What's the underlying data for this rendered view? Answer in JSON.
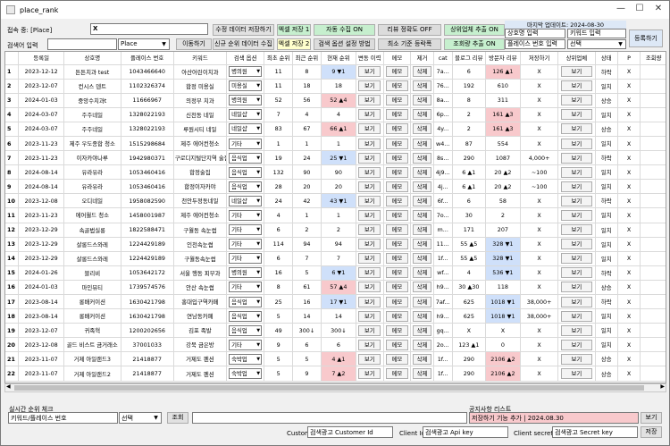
{
  "window": {
    "title": "place_rank",
    "min": "—",
    "max": "☐",
    "close": "✕"
  },
  "top": {
    "access_label": "접속 중: [Place]",
    "access_value": "X",
    "search_label": "검색어 입력",
    "place_select": "Place",
    "move_btn": "이동하기",
    "edit_save_btn": "수정 데이터 저장하기",
    "new_save_btn": "신규 순위 데이터 수집",
    "excel_save1": "엑셀 저장 1",
    "excel_save2": "엑셀 저장 2",
    "auto_collect": "자동 수집 ON",
    "search_setting": "검색 옵션 설정 방법",
    "review_off": "리뷰 정확도 OFF",
    "min_reg": "최소 기준 등락폭",
    "top_extract": "상위업체 추출 ON",
    "view_extract": "조회량 추출 ON",
    "last_update": "마지막 업데이트: 2024-08-30",
    "store_input": "상호명 입력",
    "keyword_input": "키워드 입력",
    "place_no_input": "플레이스 번호 입력",
    "select": "선택",
    "register_btn": "등록하기"
  },
  "columns": [
    "",
    "등록일",
    "상호명",
    "플레이스 번호",
    "키워드",
    "검색 옵션",
    "최초 순위",
    "최근 순위",
    "현재 순위",
    "변동 이력",
    "메모",
    "제거",
    "cat",
    "블로그 리뷰",
    "방문자 리뷰",
    "저장하기",
    "상위업체",
    "상태",
    "P",
    "조회량"
  ],
  "rows": [
    {
      "n": "1",
      "date": "2023-12-12",
      "name": "튼튼치과 test",
      "pno": "1043466640",
      "kw": "아산어린이치과",
      "opt": "병의원",
      "first": "11",
      "recent": "8",
      "cur": "9 ▼1",
      "curc": "blue",
      "cat": "7a...",
      "blog": "6",
      "visit": "126 ▲1",
      "visc": "pink",
      "save": "X",
      "state": "하락",
      "p": "X"
    },
    {
      "n": "2",
      "date": "2023-12-07",
      "name": "컨시스 덴트",
      "pno": "1102326374",
      "kw": "합정 미용실",
      "opt": "미용실",
      "first": "11",
      "recent": "18",
      "cur": "18",
      "curc": "",
      "cat": "76...",
      "blog": "192",
      "visit": "610",
      "visc": "",
      "save": "X",
      "state": "일치",
      "p": "X"
    },
    {
      "n": "3",
      "date": "2024-01-03",
      "name": "중앙수치과t",
      "pno": "11666967",
      "kw": "의정부 치과",
      "opt": "병의원",
      "first": "52",
      "recent": "56",
      "cur": "52 ▲4",
      "curc": "pink",
      "cat": "8a...",
      "blog": "8",
      "visit": "311",
      "visc": "",
      "save": "X",
      "state": "상승",
      "p": "X"
    },
    {
      "n": "4",
      "date": "2024-03-07",
      "name": "주주네일",
      "pno": "1328022193",
      "kw": "신천동 네일",
      "opt": "네일샵",
      "first": "7",
      "recent": "4",
      "cur": "4",
      "curc": "",
      "cat": "6p...",
      "blog": "2",
      "visit": "161 ▲3",
      "visc": "pink",
      "save": "X",
      "state": "일치",
      "p": "X"
    },
    {
      "n": "5",
      "date": "2024-03-07",
      "name": "주주네일",
      "pno": "1328022193",
      "kw": "루원시티 네일",
      "opt": "네일샵",
      "first": "83",
      "recent": "67",
      "cur": "66 ▲1",
      "curc": "pink",
      "cat": "4y...",
      "blog": "2",
      "visit": "161 ▲3",
      "visc": "pink",
      "save": "X",
      "state": "상승",
      "p": "X"
    },
    {
      "n": "6",
      "date": "2023-11-23",
      "name": "제주 우도종합 청소",
      "pno": "1515298684",
      "kw": "제주 에어컨청소",
      "opt": "기타",
      "first": "1",
      "recent": "1",
      "cur": "1",
      "curc": "",
      "cat": "w4...",
      "blog": "87",
      "visit": "554",
      "visc": "",
      "save": "X",
      "state": "일치",
      "p": "X"
    },
    {
      "n": "7",
      "date": "2023-11-23",
      "name": "이자카야나루",
      "pno": "1942980371",
      "kw": "구로디지털단지역 술집",
      "opt": "음식업",
      "first": "19",
      "recent": "24",
      "cur": "25 ▼1",
      "curc": "blue",
      "cat": "8s...",
      "blog": "290",
      "visit": "1087",
      "visc": "",
      "save": "4,000+",
      "state": "하락",
      "p": "X"
    },
    {
      "n": "8",
      "date": "2024-08-14",
      "name": "유라유라",
      "pno": "1053460416",
      "kw": "합정술집",
      "opt": "음식업",
      "first": "132",
      "recent": "90",
      "cur": "90",
      "curc": "",
      "cat": "4j9...",
      "blog": "6 ▲1",
      "visit": "20 ▲2",
      "visc": "",
      "save": "~100",
      "state": "일치",
      "p": "X"
    },
    {
      "n": "9",
      "date": "2024-08-14",
      "name": "유라유라",
      "pno": "1053460416",
      "kw": "합정이자카야",
      "opt": "음식업",
      "first": "28",
      "recent": "20",
      "cur": "20",
      "curc": "",
      "cat": "4j...",
      "blog": "6 ▲1",
      "visit": "20 ▲2",
      "visc": "",
      "save": "~100",
      "state": "일치",
      "p": "X"
    },
    {
      "n": "10",
      "date": "2023-12-08",
      "name": "오디네일",
      "pno": "1958082590",
      "kw": "천안두정동네일",
      "opt": "네일샵",
      "first": "24",
      "recent": "42",
      "cur": "43 ▼1",
      "curc": "blue",
      "cat": "6f...",
      "blog": "6",
      "visit": "58",
      "visc": "",
      "save": "X",
      "state": "하락",
      "p": "X"
    },
    {
      "n": "11",
      "date": "2023-11-23",
      "name": "에어월드 청소",
      "pno": "1458001987",
      "kw": "제주 에어컨청소",
      "opt": "기타",
      "first": "4",
      "recent": "1",
      "cur": "1",
      "curc": "",
      "cat": "7o...",
      "blog": "30",
      "visit": "2",
      "visc": "",
      "save": "X",
      "state": "일치",
      "p": "X"
    },
    {
      "n": "12",
      "date": "2023-12-29",
      "name": "속골법실롱",
      "pno": "1822588471",
      "kw": "구월동 속눈썹",
      "opt": "기타",
      "first": "6",
      "recent": "2",
      "cur": "2",
      "curc": "",
      "cat": "m...",
      "blog": "171",
      "visit": "207",
      "visc": "",
      "save": "X",
      "state": "일치",
      "p": "X"
    },
    {
      "n": "13",
      "date": "2023-12-29",
      "name": "샬롱드스와레",
      "pno": "1224429189",
      "kw": "인천속눈썹",
      "opt": "기타",
      "first": "114",
      "recent": "94",
      "cur": "94",
      "curc": "",
      "cat": "11...",
      "blog": "55 ▲5",
      "visit": "328 ▼1",
      "visc": "blue",
      "save": "X",
      "state": "일치",
      "p": "X"
    },
    {
      "n": "14",
      "date": "2023-12-29",
      "name": "샬롱드스와레",
      "pno": "1224429189",
      "kw": "구월동속눈썹",
      "opt": "기타",
      "first": "6",
      "recent": "7",
      "cur": "7",
      "curc": "",
      "cat": "1f...",
      "blog": "55 ▲5",
      "visit": "328 ▼1",
      "visc": "blue",
      "save": "X",
      "state": "일치",
      "p": "X"
    },
    {
      "n": "15",
      "date": "2024-01-26",
      "name": "블리비",
      "pno": "1053642172",
      "kw": "서울 행동 피부과",
      "opt": "병의원",
      "first": "16",
      "recent": "5",
      "cur": "6 ▼1",
      "curc": "blue",
      "cat": "wf...",
      "blog": "4",
      "visit": "536 ▼1",
      "visc": "blue",
      "save": "X",
      "state": "하락",
      "p": "X"
    },
    {
      "n": "16",
      "date": "2024-01-03",
      "name": "마인뷰티",
      "pno": "1739574576",
      "kw": "안산 속눈썹",
      "opt": "기타",
      "first": "8",
      "recent": "61",
      "cur": "57 ▲4",
      "curc": "pink",
      "cat": "h9...",
      "blog": "30 ▲30",
      "visit": "118",
      "visc": "",
      "save": "X",
      "state": "상승",
      "p": "X"
    },
    {
      "n": "17",
      "date": "2023-08-14",
      "name": "롱배커이션",
      "pno": "1630421798",
      "kw": "홍대입구역카페",
      "opt": "음식업",
      "first": "25",
      "recent": "16",
      "cur": "17 ▼1",
      "curc": "blue",
      "cat": "7af...",
      "blog": "625",
      "visit": "1018 ▼1",
      "visc": "blue",
      "save": "38,000+",
      "state": "하락",
      "p": "X"
    },
    {
      "n": "18",
      "date": "2023-08-14",
      "name": "롱배커이션",
      "pno": "1630421798",
      "kw": "연남동카페",
      "opt": "음식업",
      "first": "5",
      "recent": "14",
      "cur": "14",
      "curc": "",
      "cat": "h9...",
      "blog": "625",
      "visit": "1018 ▼1",
      "visc": "blue",
      "save": "38,000+",
      "state": "일치",
      "p": "X"
    },
    {
      "n": "19",
      "date": "2023-12-07",
      "name": "귀족혁",
      "pno": "1200202656",
      "kw": "김포 족발",
      "opt": "음식업",
      "first": "49",
      "recent": "300↓",
      "cur": "300↓",
      "curc": "",
      "cat": "gq...",
      "blog": "X",
      "visit": "X",
      "visc": "",
      "save": "X",
      "state": "일치",
      "p": "X"
    },
    {
      "n": "20",
      "date": "2023-12-08",
      "name": "골드 비스트 금거래소",
      "pno": "37001033",
      "kw": "강북 금은방",
      "opt": "기타",
      "first": "9",
      "recent": "6",
      "cur": "6",
      "curc": "",
      "cat": "2o...",
      "blog": "123 ▲1",
      "visit": "0",
      "visc": "",
      "save": "X",
      "state": "일치",
      "p": "X"
    },
    {
      "n": "21",
      "date": "2023-11-07",
      "name": "거제 아일랜드3",
      "pno": "21418877",
      "kw": "거제도 펜션",
      "opt": "숙박업",
      "first": "5",
      "recent": "5",
      "cur": "4 ▲1",
      "curc": "pink",
      "cat": "1f...",
      "blog": "290",
      "visit": "2106 ▲2",
      "visc": "pink",
      "save": "X",
      "state": "상승",
      "p": "X"
    },
    {
      "n": "22",
      "date": "2023-11-07",
      "name": "거제 아일랜드2",
      "pno": "21418877",
      "kw": "거제도 펜션",
      "opt": "숙박업",
      "first": "5",
      "recent": "9",
      "cur": "7 ▲2",
      "curc": "pink",
      "cat": "1f...",
      "blog": "290",
      "visit": "2106 ▲2",
      "visc": "pink",
      "save": "X",
      "state": "상승",
      "p": "X"
    }
  ],
  "cell_labels": {
    "view": "보기",
    "memo": "메모",
    "del": "삭제"
  },
  "bottom": {
    "realtime": "실시간 순위 체크",
    "kw_place": "키워드/플레이스 번호",
    "select": "선택",
    "search": "조회",
    "notice_title": "공지사항 리스트",
    "notice_value": "저장하기 기능 추가 | 2024.08.30",
    "view": "보기",
    "custom": "Custom",
    "customer_id": "검색광고 Customer Id",
    "client_id": "Client Id",
    "api_key": "검색광고 Api key",
    "client_secret": "Client secret",
    "secret_key": "검색광고 Secret key",
    "save": "저장"
  }
}
